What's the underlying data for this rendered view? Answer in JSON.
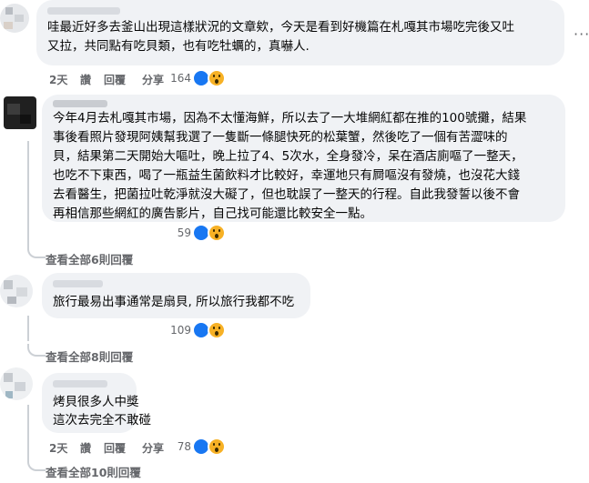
{
  "comments": [
    {
      "text_lines": [
        "哇最近好多去釜山出現這樣狀況的文章欸，今天是看到好機篇在札嘎其市場吃完後又吐",
        "又拉，共同點有吃貝類，也有吃牡蠣的，真嚇人."
      ],
      "time": "2天",
      "like_label": "讚",
      "reply_label": "回覆",
      "share_label": "分享",
      "reaction_count": "164",
      "view_replies": ""
    },
    {
      "text_lines": [
        "今年4月去札嘎其市場，因為不太懂海鮮，所以去了一大堆網紅都在推的100號攤，結果",
        "事後看照片發現阿姨幫我選了一隻斷一條腿快死的松葉蟹，然後吃了一個有苦澀味的",
        "貝，結果第二天開始大嘔吐，晚上拉了4、5次水，全身發冷，呆在酒店廁嘔了一整天，",
        "也吃不下東西，喝了一瓶益生菌飲料才比較好，幸運地只有屙嘔沒有發燒，也沒花大錢",
        "去看醫生，把菌拉吐乾淨就沒大礙了，但也耽誤了一整天的行程。自此我發誓以後不會",
        "再相信那些網紅的廣告影片，自己找可能還比較安全一點。"
      ],
      "time": "",
      "like_label": "",
      "reply_label": "",
      "share_label": "",
      "reaction_count": "59",
      "view_replies": "查看全部6則回覆"
    },
    {
      "text_lines": [
        "旅行最易出事通常是扇貝, 所以旅行我都不吃"
      ],
      "time": "",
      "like_label": "",
      "reply_label": "",
      "share_label": "",
      "reaction_count": "109",
      "view_replies": "查看全部8則回覆"
    },
    {
      "text_lines": [
        "烤貝很多人中獎",
        "這次去完全不敢碰"
      ],
      "time": "2天",
      "like_label": "讚",
      "reply_label": "回覆",
      "share_label": "分享",
      "reaction_count": "78",
      "view_replies": "查看全部10則回覆"
    }
  ],
  "more_label": "···",
  "colors": {
    "like": "#1877f2",
    "wow": "#f7b125",
    "bubble": "#f0f2f5",
    "muted": "#65676b"
  },
  "icons": [
    "like-reaction-icon",
    "wow-reaction-icon",
    "more-options-icon"
  ]
}
